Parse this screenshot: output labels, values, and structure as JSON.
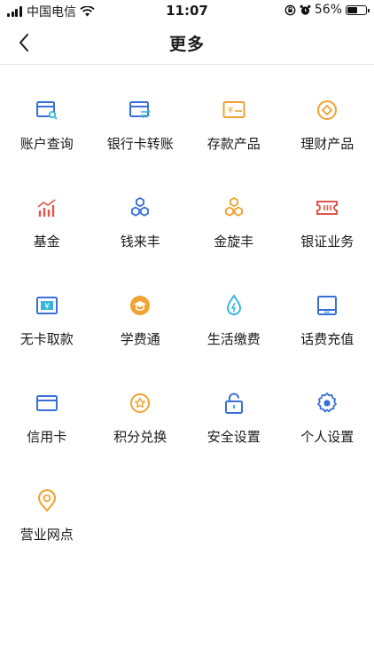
{
  "status_bar": {
    "carrier": "中国电信",
    "time": "11:07",
    "battery": "56%",
    "battery_level": 0.56
  },
  "nav": {
    "title": "更多"
  },
  "colors": {
    "blue": "#3a6fd8",
    "orange": "#f0a232",
    "red": "#e0564b",
    "teal": "#37b6d9"
  },
  "menu": [
    {
      "label": "账户查询",
      "icon": "account-query-icon"
    },
    {
      "label": "银行卡转账",
      "icon": "card-transfer-icon"
    },
    {
      "label": "存款产品",
      "icon": "deposit-icon"
    },
    {
      "label": "理财产品",
      "icon": "wealth-coin-icon"
    },
    {
      "label": "基金",
      "icon": "fund-chart-icon"
    },
    {
      "label": "钱来丰",
      "icon": "hexagons-icon"
    },
    {
      "label": "金旋丰",
      "icon": "hexagons-gold-icon"
    },
    {
      "label": "银证业务",
      "icon": "ticket-icon"
    },
    {
      "label": "无卡取款",
      "icon": "cash-icon"
    },
    {
      "label": "学费通",
      "icon": "graduation-cap-icon"
    },
    {
      "label": "生活缴费",
      "icon": "water-drop-icon"
    },
    {
      "label": "话费充值",
      "icon": "tablet-icon"
    },
    {
      "label": "信用卡",
      "icon": "credit-card-icon"
    },
    {
      "label": "积分兑换",
      "icon": "points-icon"
    },
    {
      "label": "安全设置",
      "icon": "lock-icon"
    },
    {
      "label": "个人设置",
      "icon": "gear-icon"
    },
    {
      "label": "营业网点",
      "icon": "location-pin-icon"
    }
  ]
}
